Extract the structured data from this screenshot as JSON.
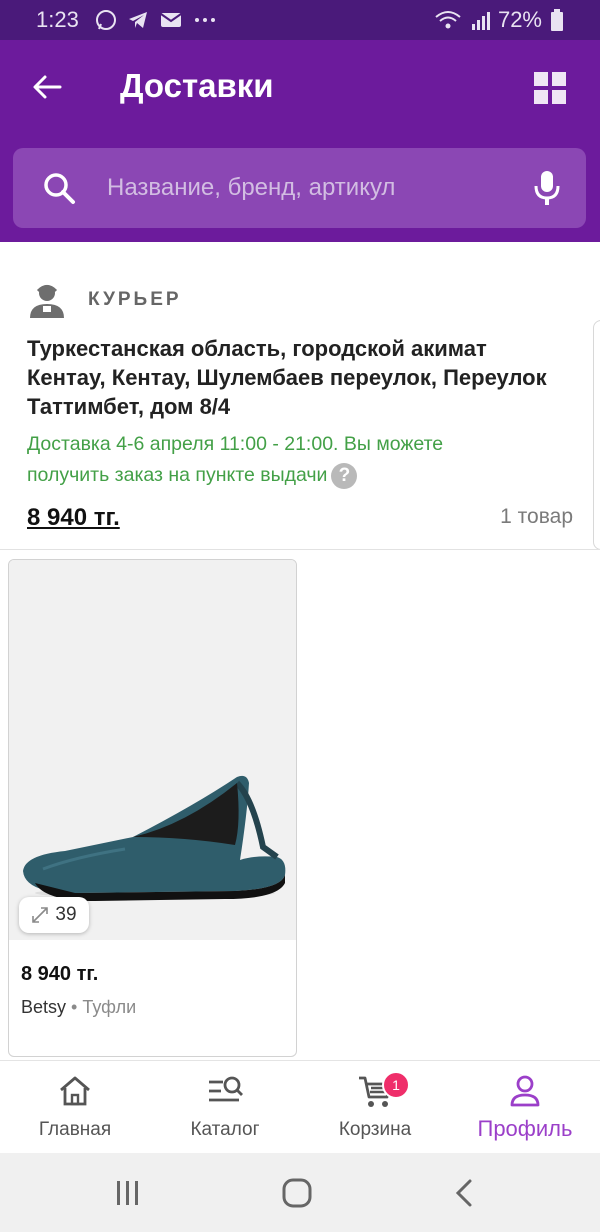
{
  "status_bar": {
    "time": "1:23",
    "battery": "72%"
  },
  "header": {
    "title": "Доставки"
  },
  "search": {
    "placeholder": "Название, бренд, артикул"
  },
  "delivery_card": {
    "method": "КУРЬЕР",
    "address": "Туркестанская область, городской акимат Кентау, Кентау, Шулембаев переулок, Переулок Таттимбет, дом 8/4",
    "delivery_info": "Доставка 4-6 апреля 11:00 - 21:00. Вы можете получить заказ на пункте выдачи",
    "price": "8 940 тг.",
    "items_count": "1 товар"
  },
  "product": {
    "size": "39",
    "price": "8 940 тг.",
    "brand": "Betsy",
    "separator": "•",
    "category": "Туфли"
  },
  "bottom_nav": {
    "items": [
      {
        "label": "Главная",
        "icon": "home-icon"
      },
      {
        "label": "Каталог",
        "icon": "catalog-icon"
      },
      {
        "label": "Корзина",
        "icon": "cart-icon",
        "badge": "1"
      },
      {
        "label": "Профиль",
        "icon": "profile-icon",
        "active": true
      }
    ]
  },
  "colors": {
    "primary": "#6c1b9c",
    "status_bar": "#4a1a7a",
    "accent": "#9b3fc9",
    "success": "#43a047",
    "badge": "#ef2e6a"
  }
}
